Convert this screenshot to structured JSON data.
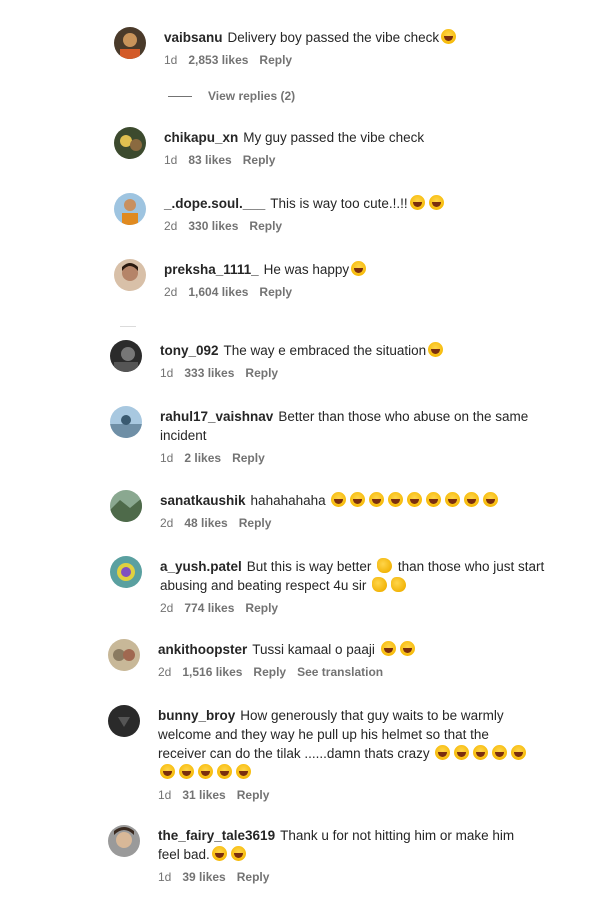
{
  "comments": [
    {
      "user": "vaibsanu",
      "text": "Delivery boy passed the vibe check",
      "emojis": 1,
      "age": "1d",
      "likes": "2,853 likes",
      "reply": "Reply",
      "avatar_color": "#4a3a2a"
    },
    {
      "user": "chikapu_xn",
      "text": "My guy passed the vibe check",
      "emojis": 0,
      "age": "1d",
      "likes": "83 likes",
      "reply": "Reply",
      "avatar_color": "#3c4a2e"
    },
    {
      "user": "_.dope.soul.___",
      "text": "This is way too cute.!.!!",
      "emojis": 2,
      "age": "2d",
      "likes": "330 likes",
      "reply": "Reply",
      "avatar_color": "#7aa0c8"
    },
    {
      "user": "preksha_1111_",
      "text": "He was happy",
      "emojis": 1,
      "age": "2d",
      "likes": "1,604 likes",
      "reply": "Reply",
      "avatar_color": "#b58468"
    },
    {
      "user": "tony_092",
      "text": "The way e embraced the situation",
      "emojis": 1,
      "age": "1d",
      "likes": "333 likes",
      "reply": "Reply",
      "avatar_color": "#2b2b2b"
    },
    {
      "user": "rahul17_vaishnav",
      "text": "Better than those who abuse on the same incident",
      "emojis": 0,
      "age": "1d",
      "likes": "2 likes",
      "reply": "Reply",
      "avatar_color": "#6f8fa6"
    },
    {
      "user": "sanatkaushik",
      "text": "hahahahaha",
      "emojis": 9,
      "age": "2d",
      "likes": "48 likes",
      "reply": "Reply",
      "avatar_color": "#4e6a4a"
    },
    {
      "user": "a_yush.patel",
      "text": "But this is way better",
      "text2": "than those who just start abusing and beating respect 4u sir",
      "age": "2d",
      "likes": "774 likes",
      "reply": "Reply",
      "avatar_color": "#5aa0a0"
    },
    {
      "user": "ankithoopster",
      "text": "Tussi kamaal o paaji",
      "emojis": 2,
      "age": "2d",
      "likes": "1,516 likes",
      "reply": "Reply",
      "translate": "See translation",
      "avatar_color": "#8a7a60"
    },
    {
      "user": "bunny_broy",
      "text": "How generously that guy waits to be warmly welcome and they way he pull up his helmet so that the receiver can do the tilak ......damn thats crazy",
      "emojis": 10,
      "age": "1d",
      "likes": "31 likes",
      "reply": "Reply",
      "avatar_color": "#2a2a2a"
    },
    {
      "user": "the_fairy_tale3619",
      "text": "Thank u for not hitting him or make him feel bad.",
      "emojis": 2,
      "age": "1d",
      "likes": "39 likes",
      "reply": "Reply",
      "avatar_color": "#4a4a4a"
    }
  ],
  "view_replies": "View replies (2)",
  "emoji_icon": "face-with-tears-of-joy-icon"
}
